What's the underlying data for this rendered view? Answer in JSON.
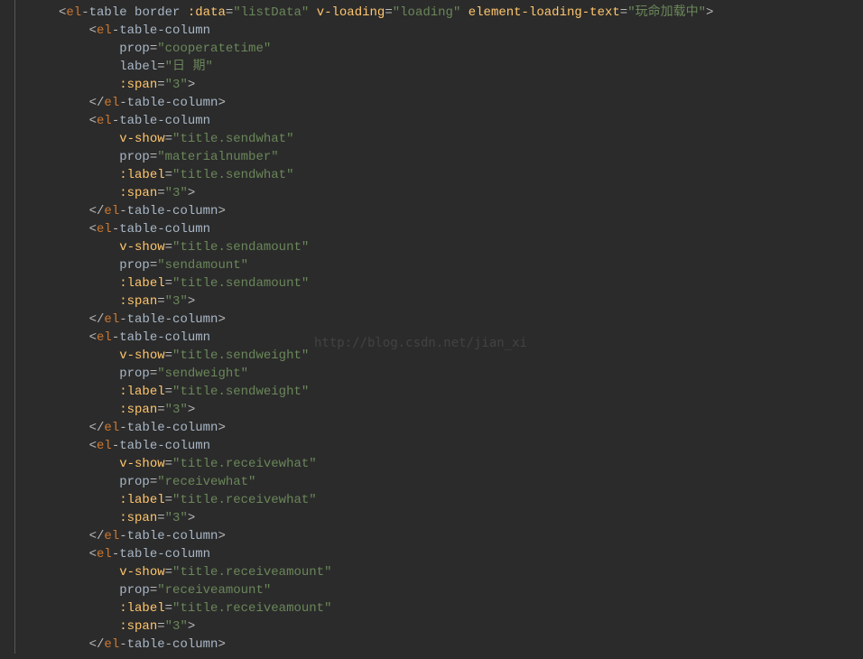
{
  "watermark": "http://blog.csdn.net/jian_xi",
  "code_lines": [
    {
      "indent": 0,
      "tokens": [
        {
          "t": "br",
          "v": "<"
        },
        {
          "t": "tn",
          "v": "el"
        },
        {
          "t": "br",
          "v": "-"
        },
        {
          "t": "an",
          "v": "table "
        },
        {
          "t": "an",
          "v": "border "
        },
        {
          "t": "dr",
          "v": ":data"
        },
        {
          "t": "eq",
          "v": "="
        },
        {
          "t": "av",
          "v": "\"listData\" "
        },
        {
          "t": "dr",
          "v": "v-loading"
        },
        {
          "t": "eq",
          "v": "="
        },
        {
          "t": "av",
          "v": "\"loading\" "
        },
        {
          "t": "dr",
          "v": "element-loading-text"
        },
        {
          "t": "eq",
          "v": "="
        },
        {
          "t": "av",
          "v": "\"玩命加载中\""
        },
        {
          "t": "br",
          "v": ">"
        }
      ]
    },
    {
      "indent": 1,
      "tokens": [
        {
          "t": "br",
          "v": "<"
        },
        {
          "t": "tn",
          "v": "el"
        },
        {
          "t": "br",
          "v": "-"
        },
        {
          "t": "an",
          "v": "table-column"
        }
      ]
    },
    {
      "indent": 2,
      "tokens": [
        {
          "t": "an",
          "v": "prop"
        },
        {
          "t": "eq",
          "v": "="
        },
        {
          "t": "av",
          "v": "\"cooperatetime\""
        }
      ]
    },
    {
      "indent": 2,
      "tokens": [
        {
          "t": "an",
          "v": "label"
        },
        {
          "t": "eq",
          "v": "="
        },
        {
          "t": "av",
          "v": "\"日 期\""
        }
      ]
    },
    {
      "indent": 2,
      "tokens": [
        {
          "t": "dr",
          "v": ":span"
        },
        {
          "t": "eq",
          "v": "="
        },
        {
          "t": "av",
          "v": "\"3\""
        },
        {
          "t": "br",
          "v": ">"
        }
      ]
    },
    {
      "indent": 1,
      "tokens": [
        {
          "t": "br",
          "v": "</"
        },
        {
          "t": "tn",
          "v": "el"
        },
        {
          "t": "br",
          "v": "-"
        },
        {
          "t": "an",
          "v": "table-column"
        },
        {
          "t": "br",
          "v": ">"
        }
      ]
    },
    {
      "indent": 1,
      "tokens": [
        {
          "t": "br",
          "v": "<"
        },
        {
          "t": "tn",
          "v": "el"
        },
        {
          "t": "br",
          "v": "-"
        },
        {
          "t": "an",
          "v": "table-column"
        }
      ]
    },
    {
      "indent": 2,
      "tokens": [
        {
          "t": "dr",
          "v": "v-show"
        },
        {
          "t": "eq",
          "v": "="
        },
        {
          "t": "av",
          "v": "\"title.sendwhat\""
        }
      ]
    },
    {
      "indent": 2,
      "tokens": [
        {
          "t": "an",
          "v": "prop"
        },
        {
          "t": "eq",
          "v": "="
        },
        {
          "t": "av",
          "v": "\"materialnumber\""
        }
      ]
    },
    {
      "indent": 2,
      "tokens": [
        {
          "t": "dr",
          "v": ":label"
        },
        {
          "t": "eq",
          "v": "="
        },
        {
          "t": "av",
          "v": "\"title.sendwhat\""
        }
      ]
    },
    {
      "indent": 2,
      "tokens": [
        {
          "t": "dr",
          "v": ":span"
        },
        {
          "t": "eq",
          "v": "="
        },
        {
          "t": "av",
          "v": "\"3\""
        },
        {
          "t": "br",
          "v": ">"
        }
      ]
    },
    {
      "indent": 1,
      "tokens": [
        {
          "t": "br",
          "v": "</"
        },
        {
          "t": "tn",
          "v": "el"
        },
        {
          "t": "br",
          "v": "-"
        },
        {
          "t": "an",
          "v": "table-column"
        },
        {
          "t": "br",
          "v": ">"
        }
      ]
    },
    {
      "indent": 1,
      "tokens": [
        {
          "t": "br",
          "v": "<"
        },
        {
          "t": "tn",
          "v": "el"
        },
        {
          "t": "br",
          "v": "-"
        },
        {
          "t": "an",
          "v": "table-column"
        }
      ]
    },
    {
      "indent": 2,
      "tokens": [
        {
          "t": "dr",
          "v": "v-show"
        },
        {
          "t": "eq",
          "v": "="
        },
        {
          "t": "av",
          "v": "\"title.sendamount\""
        }
      ]
    },
    {
      "indent": 2,
      "tokens": [
        {
          "t": "an",
          "v": "prop"
        },
        {
          "t": "eq",
          "v": "="
        },
        {
          "t": "av",
          "v": "\"sendamount\""
        }
      ]
    },
    {
      "indent": 2,
      "tokens": [
        {
          "t": "dr",
          "v": ":label"
        },
        {
          "t": "eq",
          "v": "="
        },
        {
          "t": "av",
          "v": "\"title.sendamount\""
        }
      ]
    },
    {
      "indent": 2,
      "tokens": [
        {
          "t": "dr",
          "v": ":span"
        },
        {
          "t": "eq",
          "v": "="
        },
        {
          "t": "av",
          "v": "\"3\""
        },
        {
          "t": "br",
          "v": ">"
        }
      ]
    },
    {
      "indent": 1,
      "tokens": [
        {
          "t": "br",
          "v": "</"
        },
        {
          "t": "tn",
          "v": "el"
        },
        {
          "t": "br",
          "v": "-"
        },
        {
          "t": "an",
          "v": "table-column"
        },
        {
          "t": "br",
          "v": ">"
        }
      ]
    },
    {
      "indent": 1,
      "tokens": [
        {
          "t": "br",
          "v": "<"
        },
        {
          "t": "tn",
          "v": "el"
        },
        {
          "t": "br",
          "v": "-"
        },
        {
          "t": "an",
          "v": "table-column"
        }
      ]
    },
    {
      "indent": 2,
      "tokens": [
        {
          "t": "dr",
          "v": "v-show"
        },
        {
          "t": "eq",
          "v": "="
        },
        {
          "t": "av",
          "v": "\"title.sendweight\""
        }
      ]
    },
    {
      "indent": 2,
      "tokens": [
        {
          "t": "an",
          "v": "prop"
        },
        {
          "t": "eq",
          "v": "="
        },
        {
          "t": "av",
          "v": "\"sendweight\""
        }
      ]
    },
    {
      "indent": 2,
      "tokens": [
        {
          "t": "dr",
          "v": ":label"
        },
        {
          "t": "eq",
          "v": "="
        },
        {
          "t": "av",
          "v": "\"title.sendweight\""
        }
      ]
    },
    {
      "indent": 2,
      "tokens": [
        {
          "t": "dr",
          "v": ":span"
        },
        {
          "t": "eq",
          "v": "="
        },
        {
          "t": "av",
          "v": "\"3\""
        },
        {
          "t": "br",
          "v": ">"
        }
      ]
    },
    {
      "indent": 1,
      "tokens": [
        {
          "t": "br",
          "v": "</"
        },
        {
          "t": "tn",
          "v": "el"
        },
        {
          "t": "br",
          "v": "-"
        },
        {
          "t": "an",
          "v": "table-column"
        },
        {
          "t": "br",
          "v": ">"
        }
      ]
    },
    {
      "indent": 1,
      "tokens": [
        {
          "t": "br",
          "v": "<"
        },
        {
          "t": "tn",
          "v": "el"
        },
        {
          "t": "br",
          "v": "-"
        },
        {
          "t": "an",
          "v": "table-column"
        }
      ]
    },
    {
      "indent": 2,
      "tokens": [
        {
          "t": "dr",
          "v": "v-show"
        },
        {
          "t": "eq",
          "v": "="
        },
        {
          "t": "av",
          "v": "\"title.receivewhat\""
        }
      ]
    },
    {
      "indent": 2,
      "tokens": [
        {
          "t": "an",
          "v": "prop"
        },
        {
          "t": "eq",
          "v": "="
        },
        {
          "t": "av",
          "v": "\"receivewhat\""
        }
      ]
    },
    {
      "indent": 2,
      "tokens": [
        {
          "t": "dr",
          "v": ":label"
        },
        {
          "t": "eq",
          "v": "="
        },
        {
          "t": "av",
          "v": "\"title.receivewhat\""
        }
      ]
    },
    {
      "indent": 2,
      "tokens": [
        {
          "t": "dr",
          "v": ":span"
        },
        {
          "t": "eq",
          "v": "="
        },
        {
          "t": "av",
          "v": "\"3\""
        },
        {
          "t": "br",
          "v": ">"
        }
      ]
    },
    {
      "indent": 1,
      "tokens": [
        {
          "t": "br",
          "v": "</"
        },
        {
          "t": "tn",
          "v": "el"
        },
        {
          "t": "br",
          "v": "-"
        },
        {
          "t": "an",
          "v": "table-column"
        },
        {
          "t": "br",
          "v": ">"
        }
      ]
    },
    {
      "indent": 1,
      "tokens": [
        {
          "t": "br",
          "v": "<"
        },
        {
          "t": "tn",
          "v": "el"
        },
        {
          "t": "br",
          "v": "-"
        },
        {
          "t": "an",
          "v": "table-column"
        }
      ]
    },
    {
      "indent": 2,
      "tokens": [
        {
          "t": "dr",
          "v": "v-show"
        },
        {
          "t": "eq",
          "v": "="
        },
        {
          "t": "av",
          "v": "\"title.receiveamount\""
        }
      ]
    },
    {
      "indent": 2,
      "tokens": [
        {
          "t": "an",
          "v": "prop"
        },
        {
          "t": "eq",
          "v": "="
        },
        {
          "t": "av",
          "v": "\"receiveamount\""
        }
      ]
    },
    {
      "indent": 2,
      "tokens": [
        {
          "t": "dr",
          "v": ":label"
        },
        {
          "t": "eq",
          "v": "="
        },
        {
          "t": "av",
          "v": "\"title.receiveamount\""
        }
      ]
    },
    {
      "indent": 2,
      "tokens": [
        {
          "t": "dr",
          "v": ":span"
        },
        {
          "t": "eq",
          "v": "="
        },
        {
          "t": "av",
          "v": "\"3\""
        },
        {
          "t": "br",
          "v": ">"
        }
      ]
    },
    {
      "indent": 1,
      "tokens": [
        {
          "t": "br",
          "v": "</"
        },
        {
          "t": "tn",
          "v": "el"
        },
        {
          "t": "br",
          "v": "-"
        },
        {
          "t": "an",
          "v": "table-column"
        },
        {
          "t": "br",
          "v": ">"
        }
      ]
    }
  ]
}
